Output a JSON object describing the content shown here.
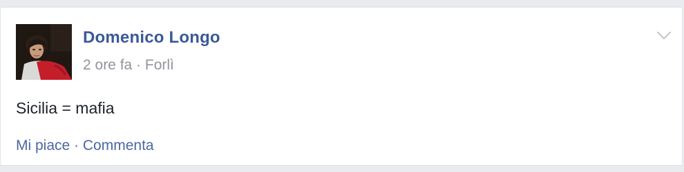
{
  "post": {
    "author_name": "Domenico Longo",
    "time": "2 ore fa",
    "separator": " · ",
    "location": "Forlì",
    "text": "Sicilia = mafia",
    "menu_icon": "chevron-down-icon"
  },
  "actions": {
    "like_label": "Mi piace",
    "separator": " · ",
    "comment_label": "Commenta"
  },
  "colors": {
    "author": "#3b5998",
    "meta": "#90949c",
    "action_link": "#4b67a1",
    "text": "#1d2129",
    "background": "#e9ebee"
  }
}
